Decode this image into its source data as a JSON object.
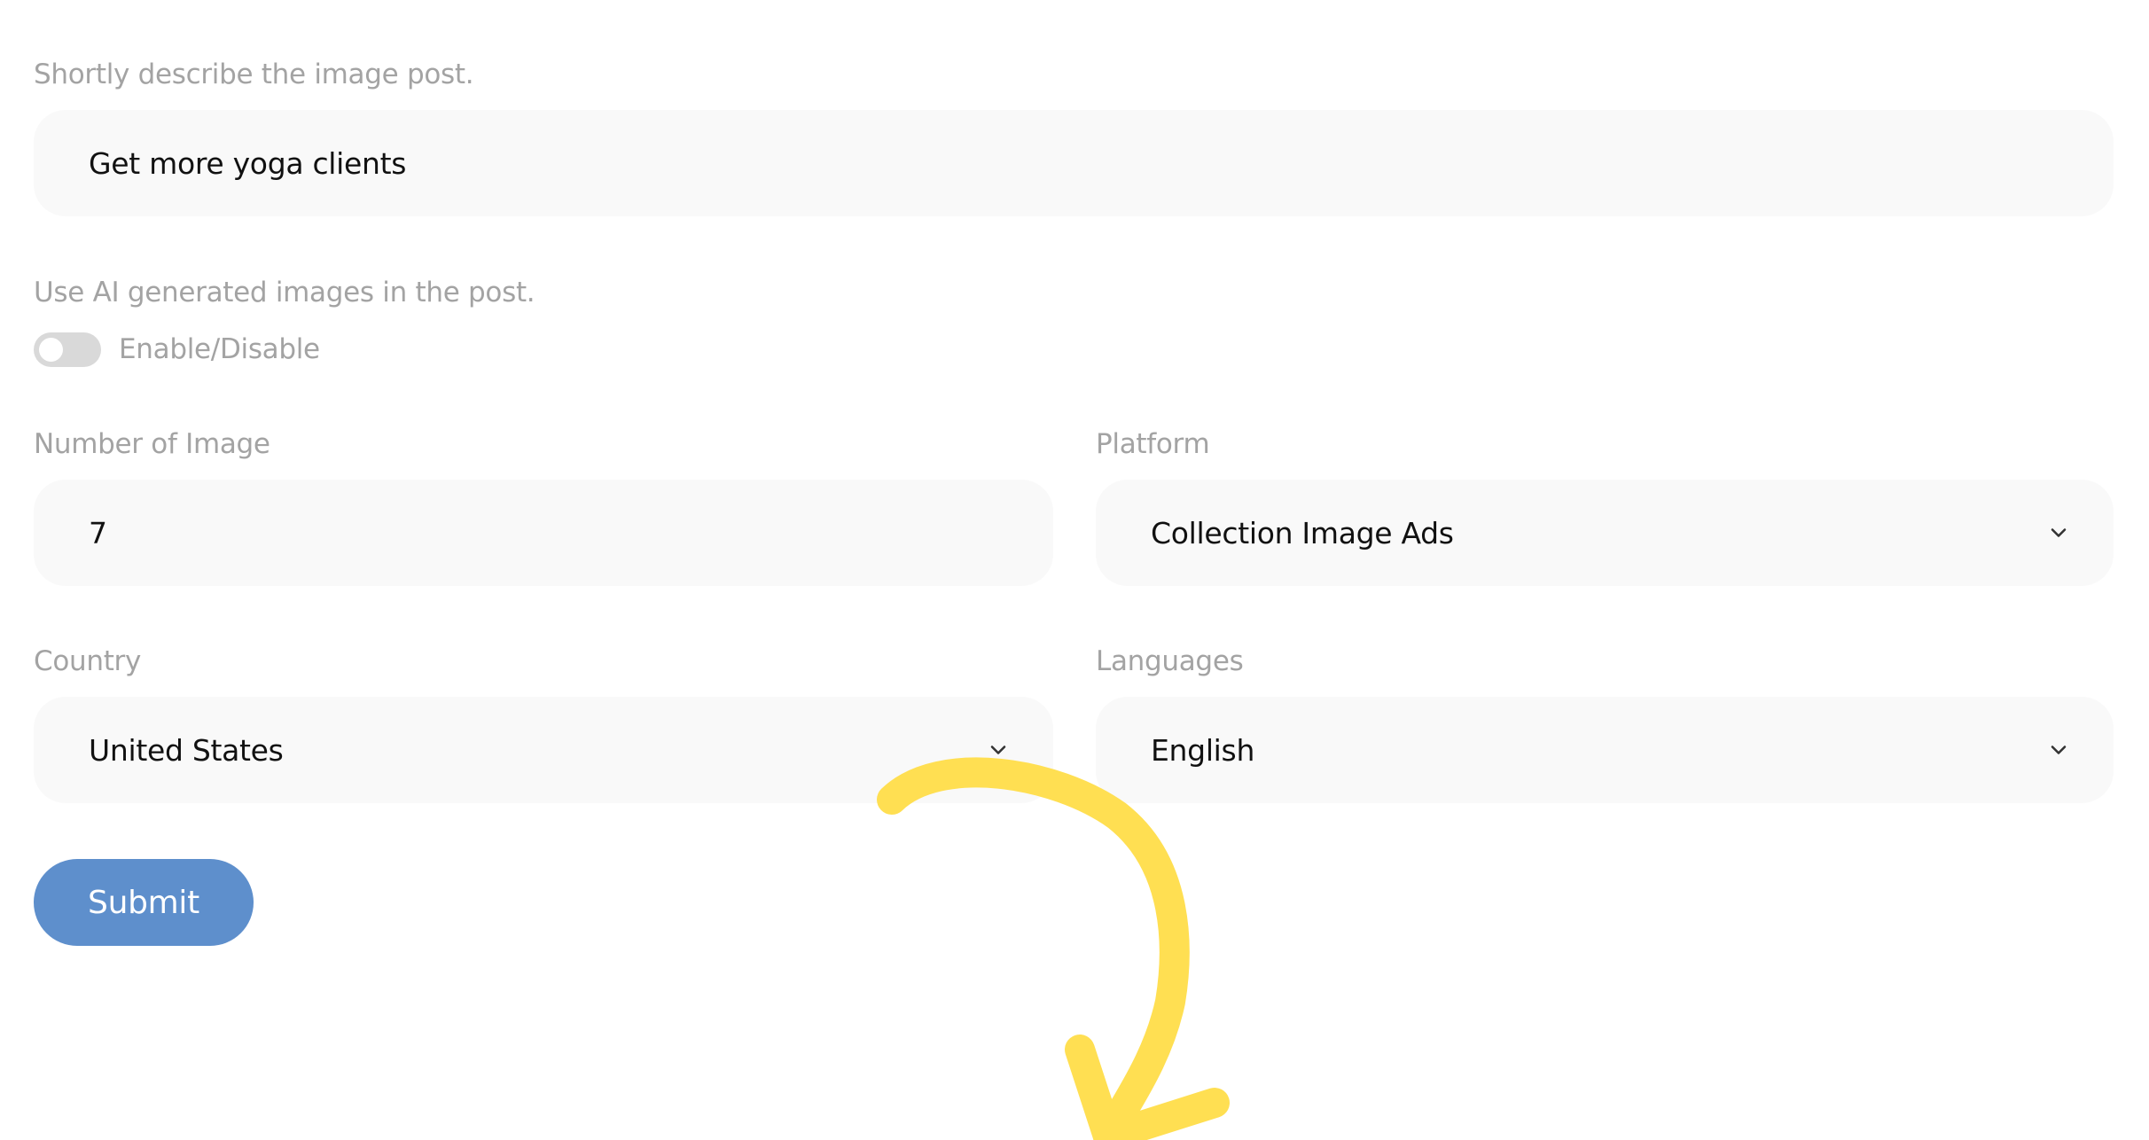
{
  "description": {
    "label": "Shortly describe the image post.",
    "value": "Get more yoga clients"
  },
  "ai_images": {
    "label": "Use AI generated images in the post.",
    "toggle_text": "Enable/Disable",
    "enabled": false
  },
  "number_of_image": {
    "label": "Number of Image",
    "value": "7"
  },
  "platform": {
    "label": "Platform",
    "selected": "Collection Image Ads"
  },
  "country": {
    "label": "Country",
    "selected": "United States"
  },
  "languages": {
    "label": "Languages",
    "selected": "English"
  },
  "submit_label": "Submit",
  "annotation": {
    "icon": "hand-drawn-arrow-icon",
    "color": "#ffdf52"
  },
  "colors": {
    "field_bg": "#f9f9f9",
    "label": "#a3a3a3",
    "submit_bg": "#5e8fcc",
    "toggle_off": "#d9d9d9"
  }
}
